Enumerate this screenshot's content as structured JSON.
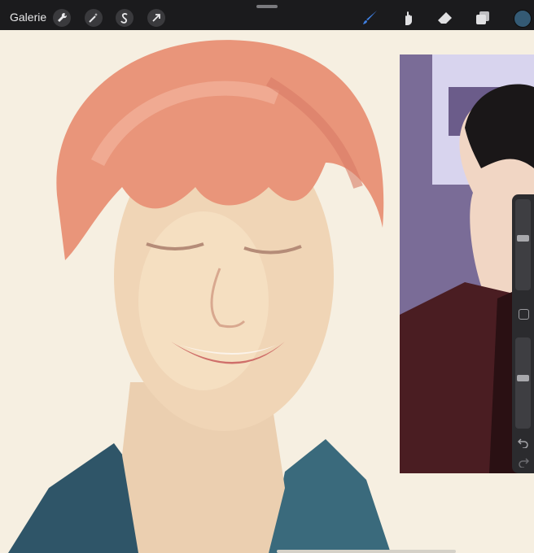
{
  "app": {
    "gallery_label": "Galerie"
  },
  "toolbar": {
    "left_tools": [
      "wrench-icon",
      "magic-wand-icon",
      "selection-s-icon",
      "transform-arrow-icon"
    ],
    "right_tools": [
      "brush-icon",
      "smudge-icon",
      "eraser-icon",
      "layers-icon"
    ],
    "active_tool": "brush-icon",
    "current_color": "#345a74"
  },
  "sidebar": {
    "brush_size_level": 0.58,
    "opacity_level": 0.56,
    "icons": [
      "modifier-square-icon",
      "undo-icon",
      "redo-icon"
    ]
  },
  "canvas": {
    "background_color": "#f6efe1",
    "reference_image": "reference-photo"
  }
}
